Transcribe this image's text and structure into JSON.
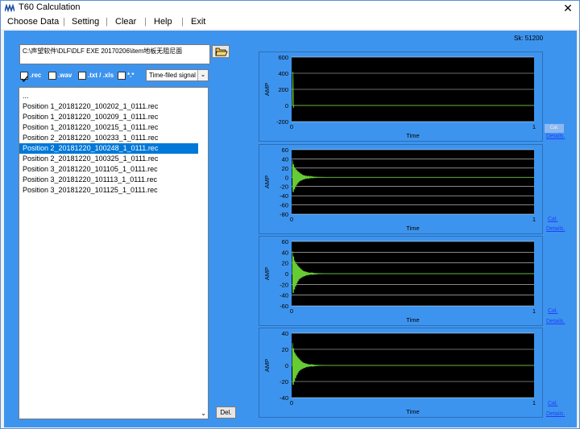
{
  "window": {
    "title": "T60 Calculation",
    "close_label": "✕"
  },
  "menu": [
    "Choose Data",
    "Setting",
    "Clear",
    "Help",
    "Exit"
  ],
  "path": "C:\\声望软件\\DLF\\DLF EXE 20170206\\item地板无阻尼面",
  "filters": [
    {
      "label": ".rec",
      "checked": true
    },
    {
      "label": ".wav",
      "checked": false
    },
    {
      "label": ".txt / .xls",
      "checked": false
    },
    {
      "label": "*.*",
      "checked": false
    }
  ],
  "signal_select": "Time-filed signal",
  "files": [
    "...",
    "Position 1_20181220_100202_1_0111.rec",
    "Position 1_20181220_100209_1_0111.rec",
    "Position 1_20181220_100215_1_0111.rec",
    "Position 2_20181220_100233_1_0111.rec",
    "Position 2_20181220_100248_1_0111.rec",
    "Position 2_20181220_100325_1_0111.rec",
    "Position 3_20181220_101105_1_0111.rec",
    "Position 3_20181220_101113_1_0111.rec",
    "Position 3_20181220_101125_1_0111.rec"
  ],
  "selected_file_index": 5,
  "del_label": "Del.",
  "sk_label": "Sk:  51200",
  "side_links": {
    "cal": "Cal.",
    "details": "Details."
  },
  "colors": {
    "panel_bg": "#3d94ee",
    "plot_bg": "#000000",
    "signal": "#66cc33",
    "selected": "#0078d7"
  },
  "chart_data": [
    {
      "type": "line",
      "xlabel": "Time",
      "ylabel": "AMP",
      "xlim": [
        0,
        1
      ],
      "ylim": [
        -200,
        600
      ],
      "yticks": [
        600,
        400,
        200,
        0,
        -200
      ],
      "xticks": [
        0,
        1
      ],
      "peak": 420,
      "decay": "impulse",
      "cal_enabled": false
    },
    {
      "type": "line",
      "xlabel": "Time",
      "ylabel": "AMP",
      "xlim": [
        0,
        1
      ],
      "ylim": [
        -80,
        60
      ],
      "yticks": [
        60,
        40,
        20,
        0,
        -20,
        -40,
        -60,
        -80
      ],
      "xticks": [
        0,
        1
      ],
      "peak": 40,
      "decay": "damped",
      "cal_enabled": true
    },
    {
      "type": "line",
      "xlabel": "Time",
      "ylabel": "AMP",
      "xlim": [
        0,
        1
      ],
      "ylim": [
        -60,
        60
      ],
      "yticks": [
        60,
        40,
        20,
        0,
        -20,
        -40,
        -60
      ],
      "xticks": [
        0,
        1
      ],
      "peak": 45,
      "decay": "damped",
      "cal_enabled": true
    },
    {
      "type": "line",
      "xlabel": "Time",
      "ylabel": "AMP",
      "xlim": [
        0,
        1
      ],
      "ylim": [
        -40,
        40
      ],
      "yticks": [
        40,
        20,
        0,
        -20,
        -40
      ],
      "xticks": [
        0,
        1
      ],
      "peak": 30,
      "decay": "damped",
      "cal_enabled": true
    }
  ]
}
